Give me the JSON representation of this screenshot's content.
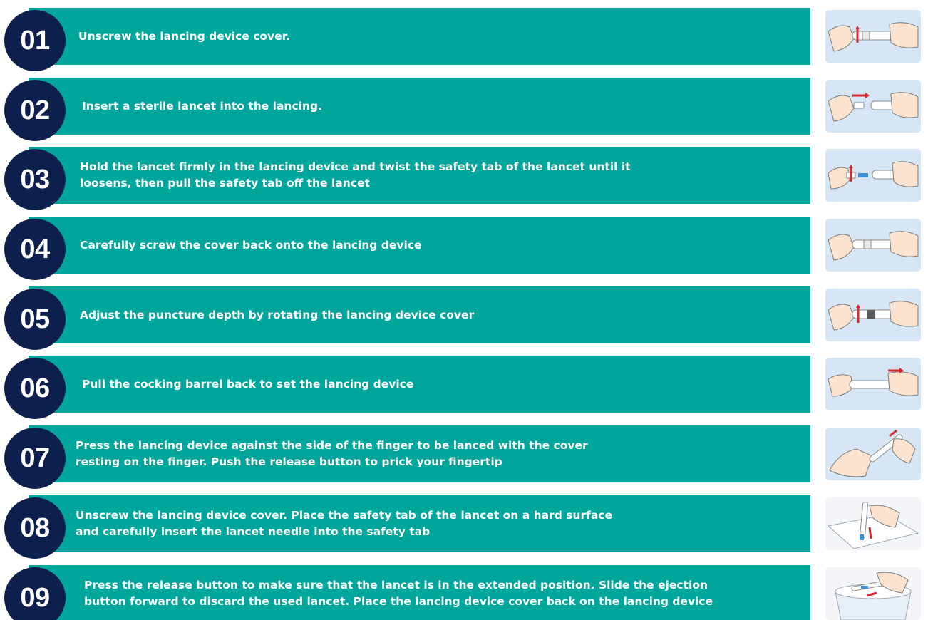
{
  "steps": [
    {
      "number": "01",
      "text": "Unscrew the lancing device cover.",
      "icon": "hands-unscrew-cover-icon"
    },
    {
      "number": "02",
      "text": "Insert a sterile lancet into the lancing.",
      "icon": "hands-insert-lancet-icon"
    },
    {
      "number": "03",
      "text": "Hold the lancet firmly in the lancing device and twist the safety tab of the lancet until it\nloosens, then pull the safety tab off the lancet",
      "icon": "hands-twist-safety-tab-icon"
    },
    {
      "number": "04",
      "text": "Carefully screw the cover back onto the lancing device",
      "icon": "hands-screw-cover-icon"
    },
    {
      "number": "05",
      "text": "Adjust the puncture depth by rotating the lancing device cover",
      "icon": "hands-adjust-depth-icon"
    },
    {
      "number": "06",
      "text": "Pull the cocking barrel back to set the lancing device",
      "icon": "hands-pull-barrel-icon"
    },
    {
      "number": "07",
      "text": "Press the lancing device against the side of the finger to be lanced with the cover\nresting on the finger. Push the release button to prick your fingertip",
      "icon": "hand-prick-finger-icon"
    },
    {
      "number": "08",
      "text": "Unscrew the lancing device cover. Place the safety tab of the lancet on a hard surface\nand carefully insert the lancet needle into the safety tab",
      "icon": "lancet-on-surface-icon"
    },
    {
      "number": "09",
      "text": "Press the release button to make sure that the lancet is in the extended position. Slide the ejection\nbutton forward to discard the used lancet. Place the lancing device cover back on the lancing device",
      "icon": "discard-lancet-icon"
    }
  ],
  "colors": {
    "bar": "#00a59c",
    "badge": "#0d1f4c",
    "text": "#ffffff",
    "picture_bg": "#d7e6f5"
  }
}
